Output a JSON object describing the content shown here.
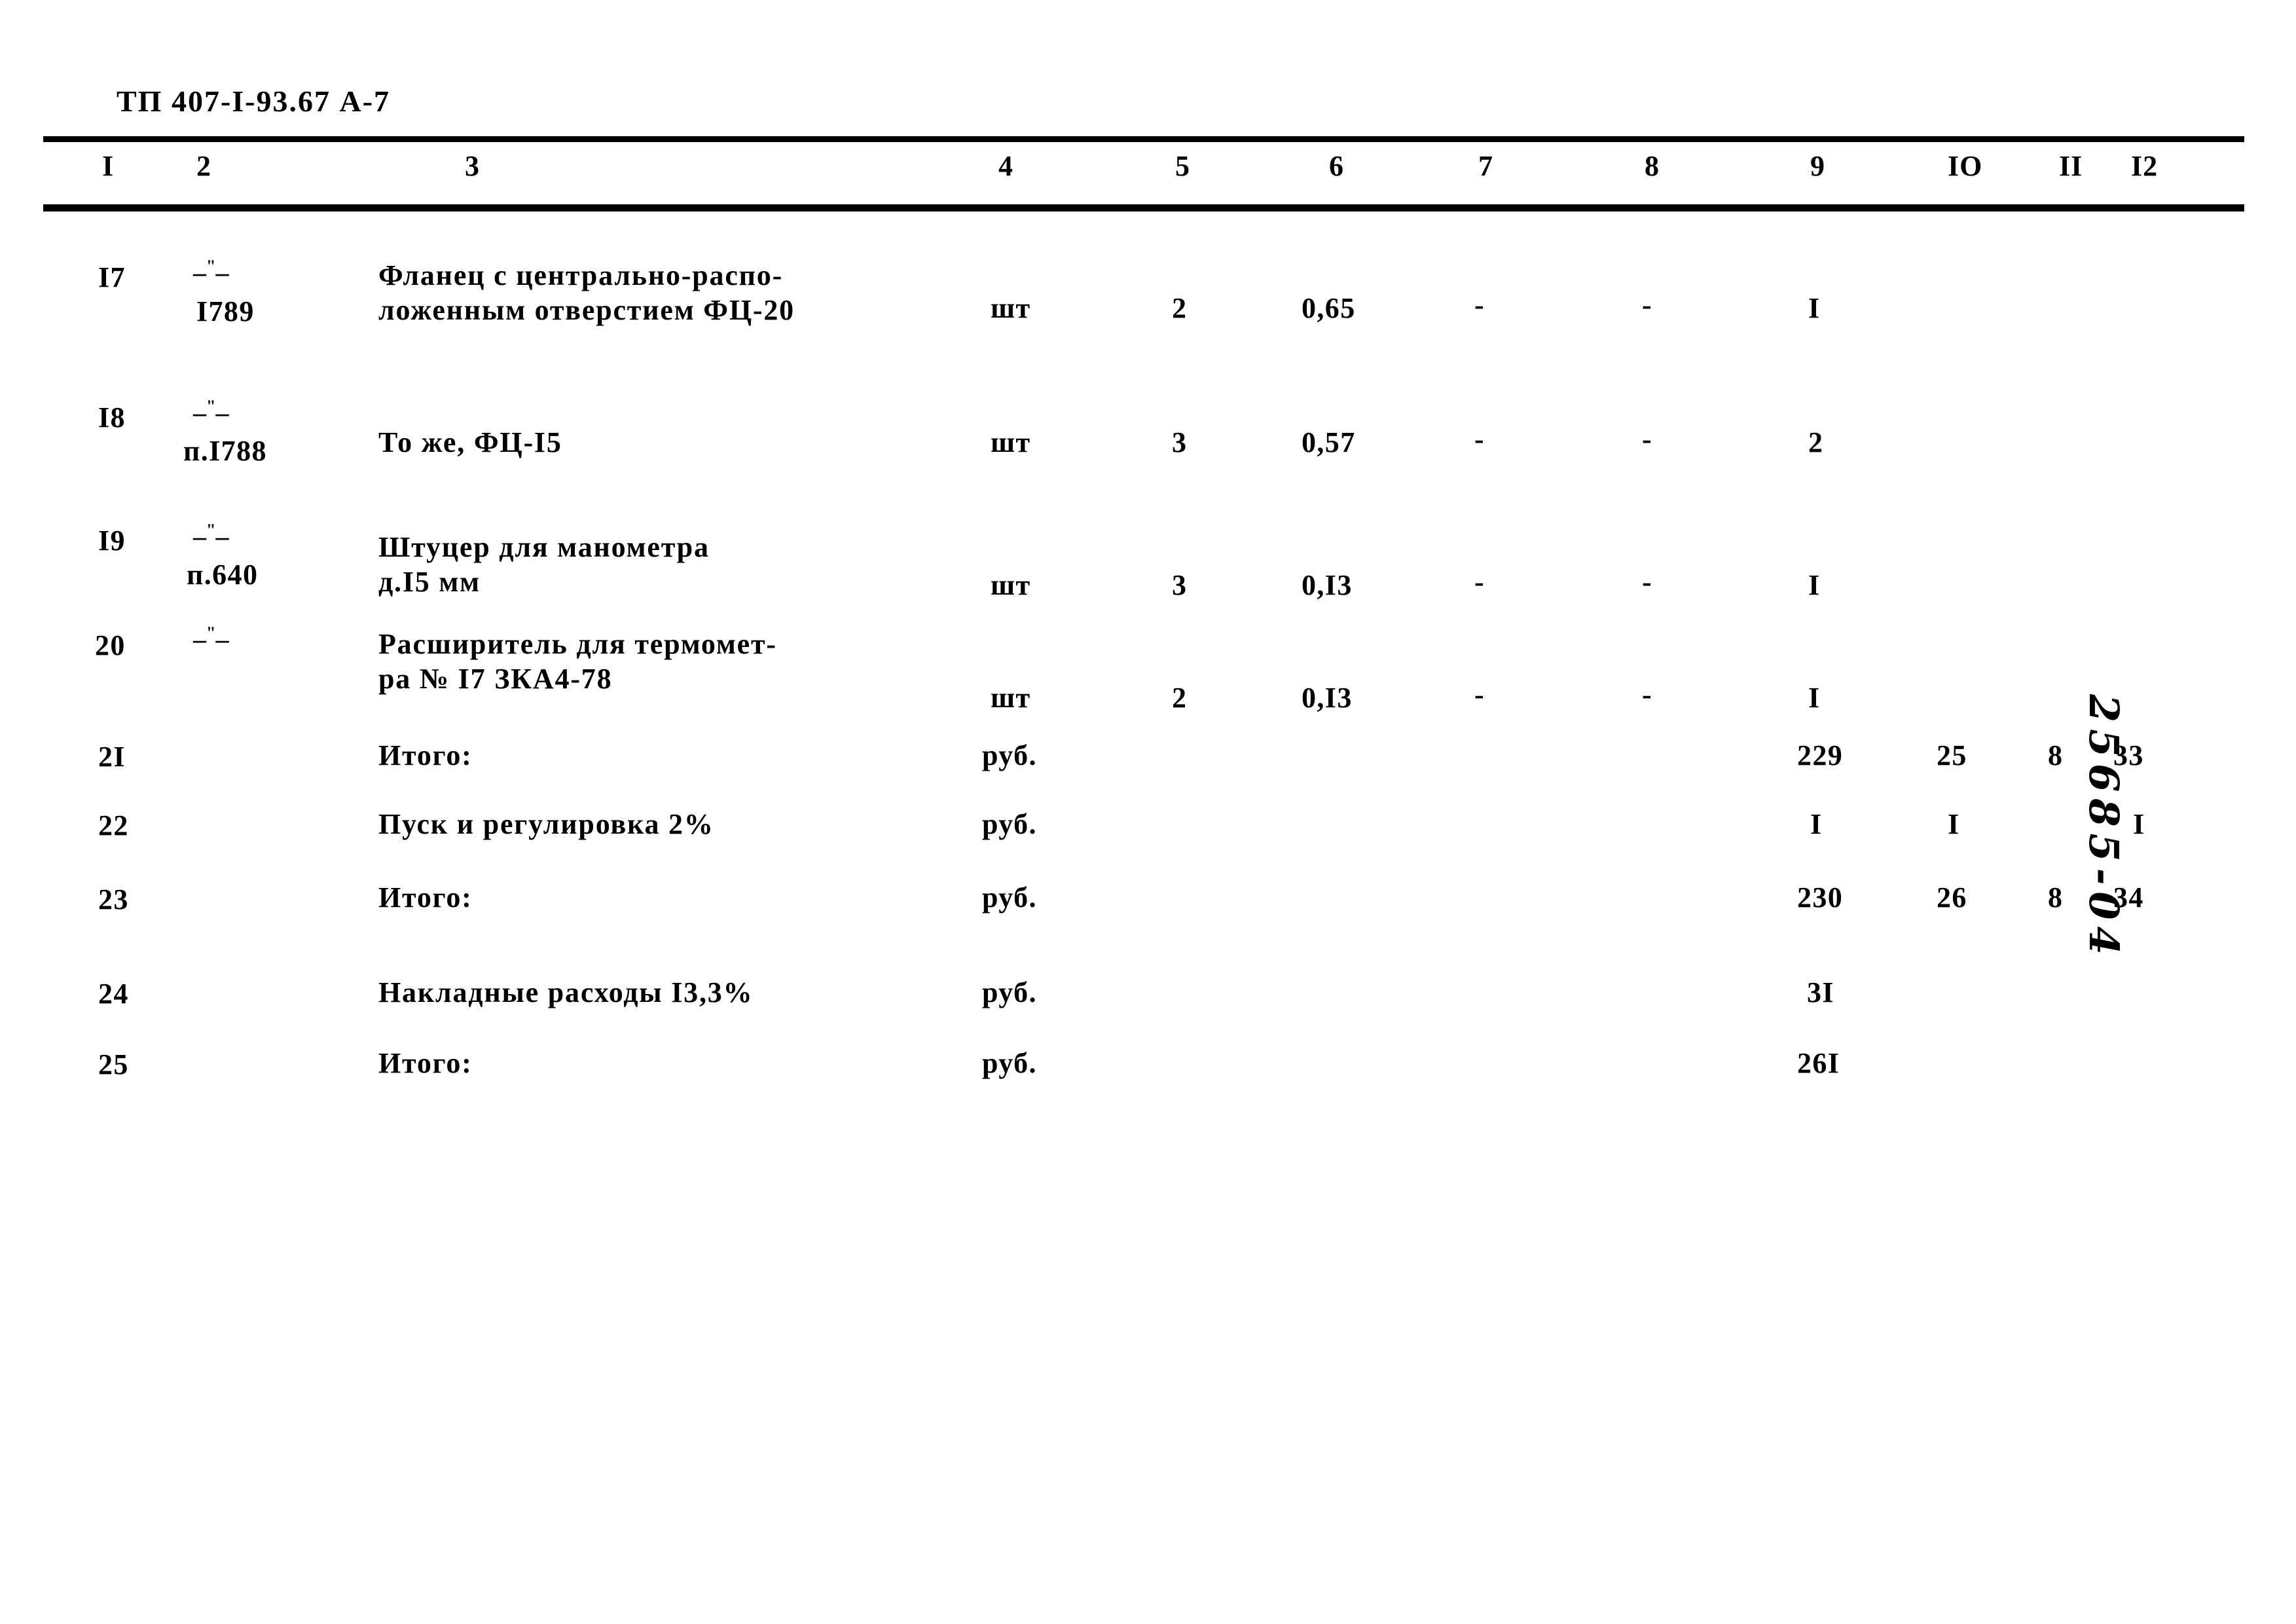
{
  "document": {
    "code": "ТП 407-I-93.67 А-7",
    "archive_number": "25685-04",
    "background_color": "#ffffff",
    "ink_color": "#000000"
  },
  "table": {
    "column_headers": [
      "I",
      "2",
      "3",
      "4",
      "5",
      "6",
      "7",
      "8",
      "9",
      "IO",
      "II",
      "I2"
    ],
    "rows": [
      {
        "c1": "I7",
        "c2_ditto": "-\"-",
        "c2_ref": "I789",
        "c3_line1": "Фланец с центрально-распо-",
        "c3_line2": "ложенным отверстием ФЦ-20",
        "c4": "шт",
        "c5": "2",
        "c6": "0,65",
        "c7": "-",
        "c8": "-",
        "c9": "I",
        "c10": "",
        "c11": "",
        "c12": ""
      },
      {
        "c1": "I8",
        "c2_ditto": "-\"-",
        "c2_ref": "п.I788",
        "c3_line1": "То же, ФЦ-I5",
        "c3_line2": "",
        "c4": "шт",
        "c5": "3",
        "c6": "0,57",
        "c7": "-",
        "c8": "-",
        "c9": "2",
        "c10": "",
        "c11": "",
        "c12": ""
      },
      {
        "c1": "I9",
        "c2_ditto": "-\"-",
        "c2_ref": "п.640",
        "c3_line1": "Штуцер для манометра",
        "c3_line2": "д.I5 мм",
        "c4": "шт",
        "c5": "3",
        "c6": "0,I3",
        "c7": "-",
        "c8": "-",
        "c9": "I",
        "c10": "",
        "c11": "",
        "c12": ""
      },
      {
        "c1": "20",
        "c2_ditto": "-\"-",
        "c2_ref": "",
        "c3_line1": "Расширитель для термомет-",
        "c3_line2": "ра № I7 ЗКА4-78",
        "c4": "шт",
        "c5": "2",
        "c6": "0,I3",
        "c7": "-",
        "c8": "-",
        "c9": "I",
        "c10": "",
        "c11": "",
        "c12": ""
      },
      {
        "c1": "2I",
        "c2_ditto": "",
        "c2_ref": "",
        "c3_line1": "Итого:",
        "c3_line2": "",
        "c4": "руб.",
        "c5": "",
        "c6": "",
        "c7": "",
        "c8": "",
        "c9": "229",
        "c10": "25",
        "c11": "8",
        "c12": "33"
      },
      {
        "c1": "22",
        "c2_ditto": "",
        "c2_ref": "",
        "c3_line1": "Пуск и регулировка 2%",
        "c3_line2": "",
        "c4": "руб.",
        "c5": "",
        "c6": "",
        "c7": "",
        "c8": "",
        "c9": "I",
        "c10": "I",
        "c11": "",
        "c12": "I"
      },
      {
        "c1": "23",
        "c2_ditto": "",
        "c2_ref": "",
        "c3_line1": "Итого:",
        "c3_line2": "",
        "c4": "руб.",
        "c5": "",
        "c6": "",
        "c7": "",
        "c8": "",
        "c9": "230",
        "c10": "26",
        "c11": "8",
        "c12": "34"
      },
      {
        "c1": "24",
        "c2_ditto": "",
        "c2_ref": "",
        "c3_line1": "Накладные расходы I3,3%",
        "c3_line2": "",
        "c4": "руб.",
        "c5": "",
        "c6": "",
        "c7": "",
        "c8": "",
        "c9": "3I",
        "c10": "",
        "c11": "",
        "c12": ""
      },
      {
        "c1": "25",
        "c2_ditto": "",
        "c2_ref": "",
        "c3_line1": "Итого:",
        "c3_line2": "",
        "c4": "руб.",
        "c5": "",
        "c6": "",
        "c7": "",
        "c8": "",
        "c9": "26I",
        "c10": "",
        "c11": "",
        "c12": ""
      }
    ]
  }
}
